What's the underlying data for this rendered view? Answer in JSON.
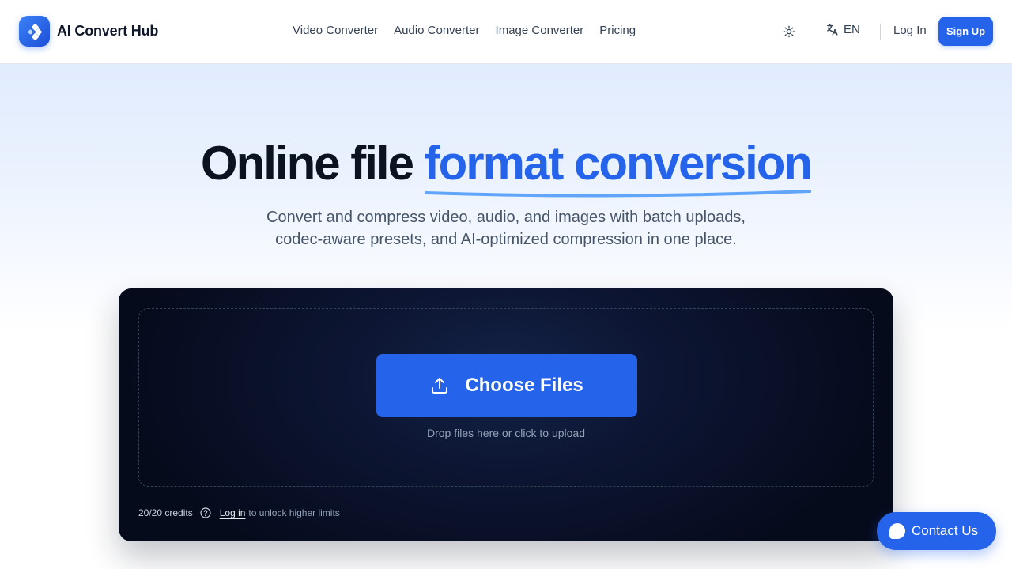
{
  "header": {
    "brand": "AI Convert Hub",
    "nav": [
      "Video Converter",
      "Audio Converter",
      "Image Converter",
      "Pricing"
    ],
    "lang": "EN",
    "login": "Log In",
    "signup": "Sign Up"
  },
  "hero": {
    "title_plain": "Online file ",
    "title_highlight": "format conversion",
    "subtitle_line1": "Convert and compress video, audio, and images with batch uploads,",
    "subtitle_line2": "codec-aware presets, and AI-optimized compression in one place."
  },
  "upload": {
    "button": "Choose Files",
    "hint": "Drop files here or click to upload",
    "credits": "20/20 credits",
    "login_link": "Log in",
    "unlock": "to unlock higher limits"
  },
  "contact": {
    "label": "Contact Us"
  },
  "colors": {
    "accent": "#2563eb",
    "card_bg": "#0c1532"
  },
  "icons": [
    "logo-icon",
    "sun-icon",
    "translate-icon",
    "upload-icon",
    "help-icon",
    "chat-icon"
  ]
}
